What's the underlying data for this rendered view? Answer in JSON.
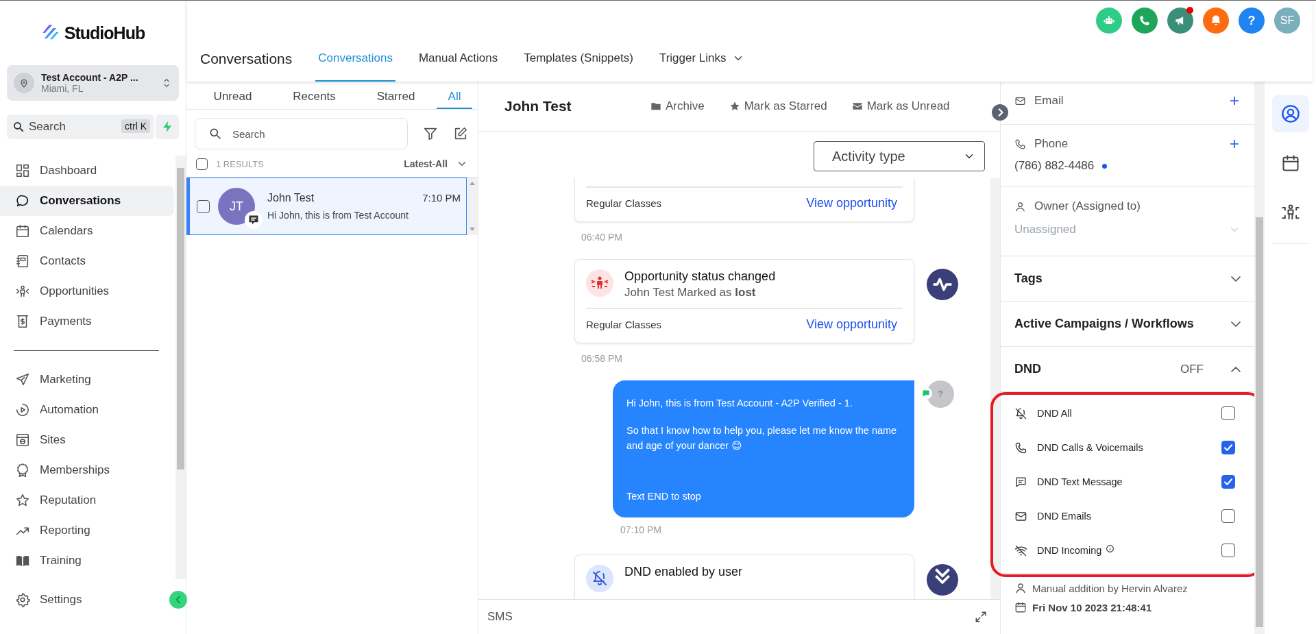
{
  "brand": {
    "name": "StudioHub"
  },
  "account": {
    "name": "Test Account - A2P ...",
    "location": "Miami, FL"
  },
  "search": {
    "placeholder": "Search",
    "shortcut": "ctrl K"
  },
  "nav": {
    "main": [
      {
        "label": "Dashboard",
        "selected": false
      },
      {
        "label": "Conversations",
        "selected": true
      },
      {
        "label": "Calendars",
        "selected": false
      },
      {
        "label": "Contacts",
        "selected": false
      },
      {
        "label": "Opportunities",
        "selected": false
      },
      {
        "label": "Payments",
        "selected": false
      }
    ],
    "more": [
      {
        "label": "Marketing",
        "selected": false
      },
      {
        "label": "Automation",
        "selected": false
      },
      {
        "label": "Sites",
        "selected": false
      },
      {
        "label": "Memberships",
        "selected": false
      },
      {
        "label": "Reputation",
        "selected": false
      },
      {
        "label": "Reporting",
        "selected": false
      },
      {
        "label": "Training",
        "selected": false
      }
    ],
    "settings": {
      "label": "Settings"
    }
  },
  "header": {
    "title": "Conversations",
    "tabs": [
      {
        "label": "Conversations",
        "selected": true,
        "dropdown": false
      },
      {
        "label": "Manual Actions",
        "selected": false,
        "dropdown": false
      },
      {
        "label": "Templates (Snippets)",
        "selected": false,
        "dropdown": false
      },
      {
        "label": "Trigger Links",
        "selected": false,
        "dropdown": true
      }
    ]
  },
  "top_actions": [
    {
      "color": "#2ecc85",
      "badge": false
    },
    {
      "color": "#1fa55a",
      "badge": false
    },
    {
      "color": "#3b8f78",
      "badge": true
    },
    {
      "color": "#ff6b0f",
      "badge": false
    },
    {
      "color": "#1e84f2",
      "badge": false,
      "label": "?"
    }
  ],
  "user": {
    "initials": "SF"
  },
  "filters": [
    {
      "label": "Unread",
      "selected": false
    },
    {
      "label": "Recents",
      "selected": false
    },
    {
      "label": "Starred",
      "selected": false
    },
    {
      "label": "All",
      "selected": true
    }
  ],
  "list_search": {
    "placeholder": "Search"
  },
  "results": {
    "count": "1 RESULTS",
    "sort": "Latest-All",
    "checked": false
  },
  "conversations": [
    {
      "initials": "JT",
      "name": "John Test",
      "time": "7:10 PM",
      "preview": "Hi John, this is from Test Account",
      "selected": true,
      "checked": false
    }
  ],
  "contact_header": {
    "name": "John Test",
    "actions": [
      "Archive",
      "Mark as Starred",
      "Mark as Unread"
    ]
  },
  "activity_filter": {
    "placeholder": "Activity type"
  },
  "feed": [
    {
      "kind": "opportunity",
      "pipeline": "Regular Classes",
      "link": "View opportunity",
      "time": "06:40 PM"
    },
    {
      "kind": "opportunity",
      "title": "Opportunity status changed",
      "text": "John Test Marked as **lost**",
      "pipeline": "Regular Classes",
      "link": "View opportunity",
      "time": "06:58 PM"
    },
    {
      "kind": "message",
      "avatar": "?",
      "lines": [
        "Hi John, this is  from Test Account - A2P Verified - 1.",
        "So that I know how to help you, please let me know the name and age of your dancer 😊",
        "Text END to stop"
      ],
      "time": "07:10 PM"
    },
    {
      "kind": "dnd",
      "title": "DND enabled by user"
    }
  ],
  "composer": {
    "channel": "SMS"
  },
  "contact_fields": [
    {
      "kind": "add",
      "label": "Email"
    },
    {
      "kind": "add",
      "label": "Phone",
      "value": "(786) 882-4486"
    },
    {
      "kind": "select",
      "label": "Owner (Assigned to)",
      "value": "Unassigned"
    }
  ],
  "sections": [
    {
      "title": "Tags",
      "expanded": false
    },
    {
      "title": "Active Campaigns / Workflows",
      "expanded": false
    },
    {
      "title": "DND",
      "status": "OFF",
      "expanded": true
    }
  ],
  "dnd": {
    "highlighted": true,
    "options": [
      {
        "label": "DND All",
        "checked": false,
        "info": false
      },
      {
        "label": "DND Calls & Voicemails",
        "checked": true,
        "info": false
      },
      {
        "label": "DND Text Message",
        "checked": true,
        "info": false
      },
      {
        "label": "DND Emails",
        "checked": false,
        "info": false
      },
      {
        "label": "DND Incoming",
        "checked": false,
        "info": true
      }
    ],
    "author": "Manual addition by Hervin Alvarez",
    "date": "Fri Nov 10 2023 21:48:41"
  },
  "rail": [
    {
      "selected": true
    },
    {
      "selected": false
    },
    {
      "selected": false
    }
  ]
}
